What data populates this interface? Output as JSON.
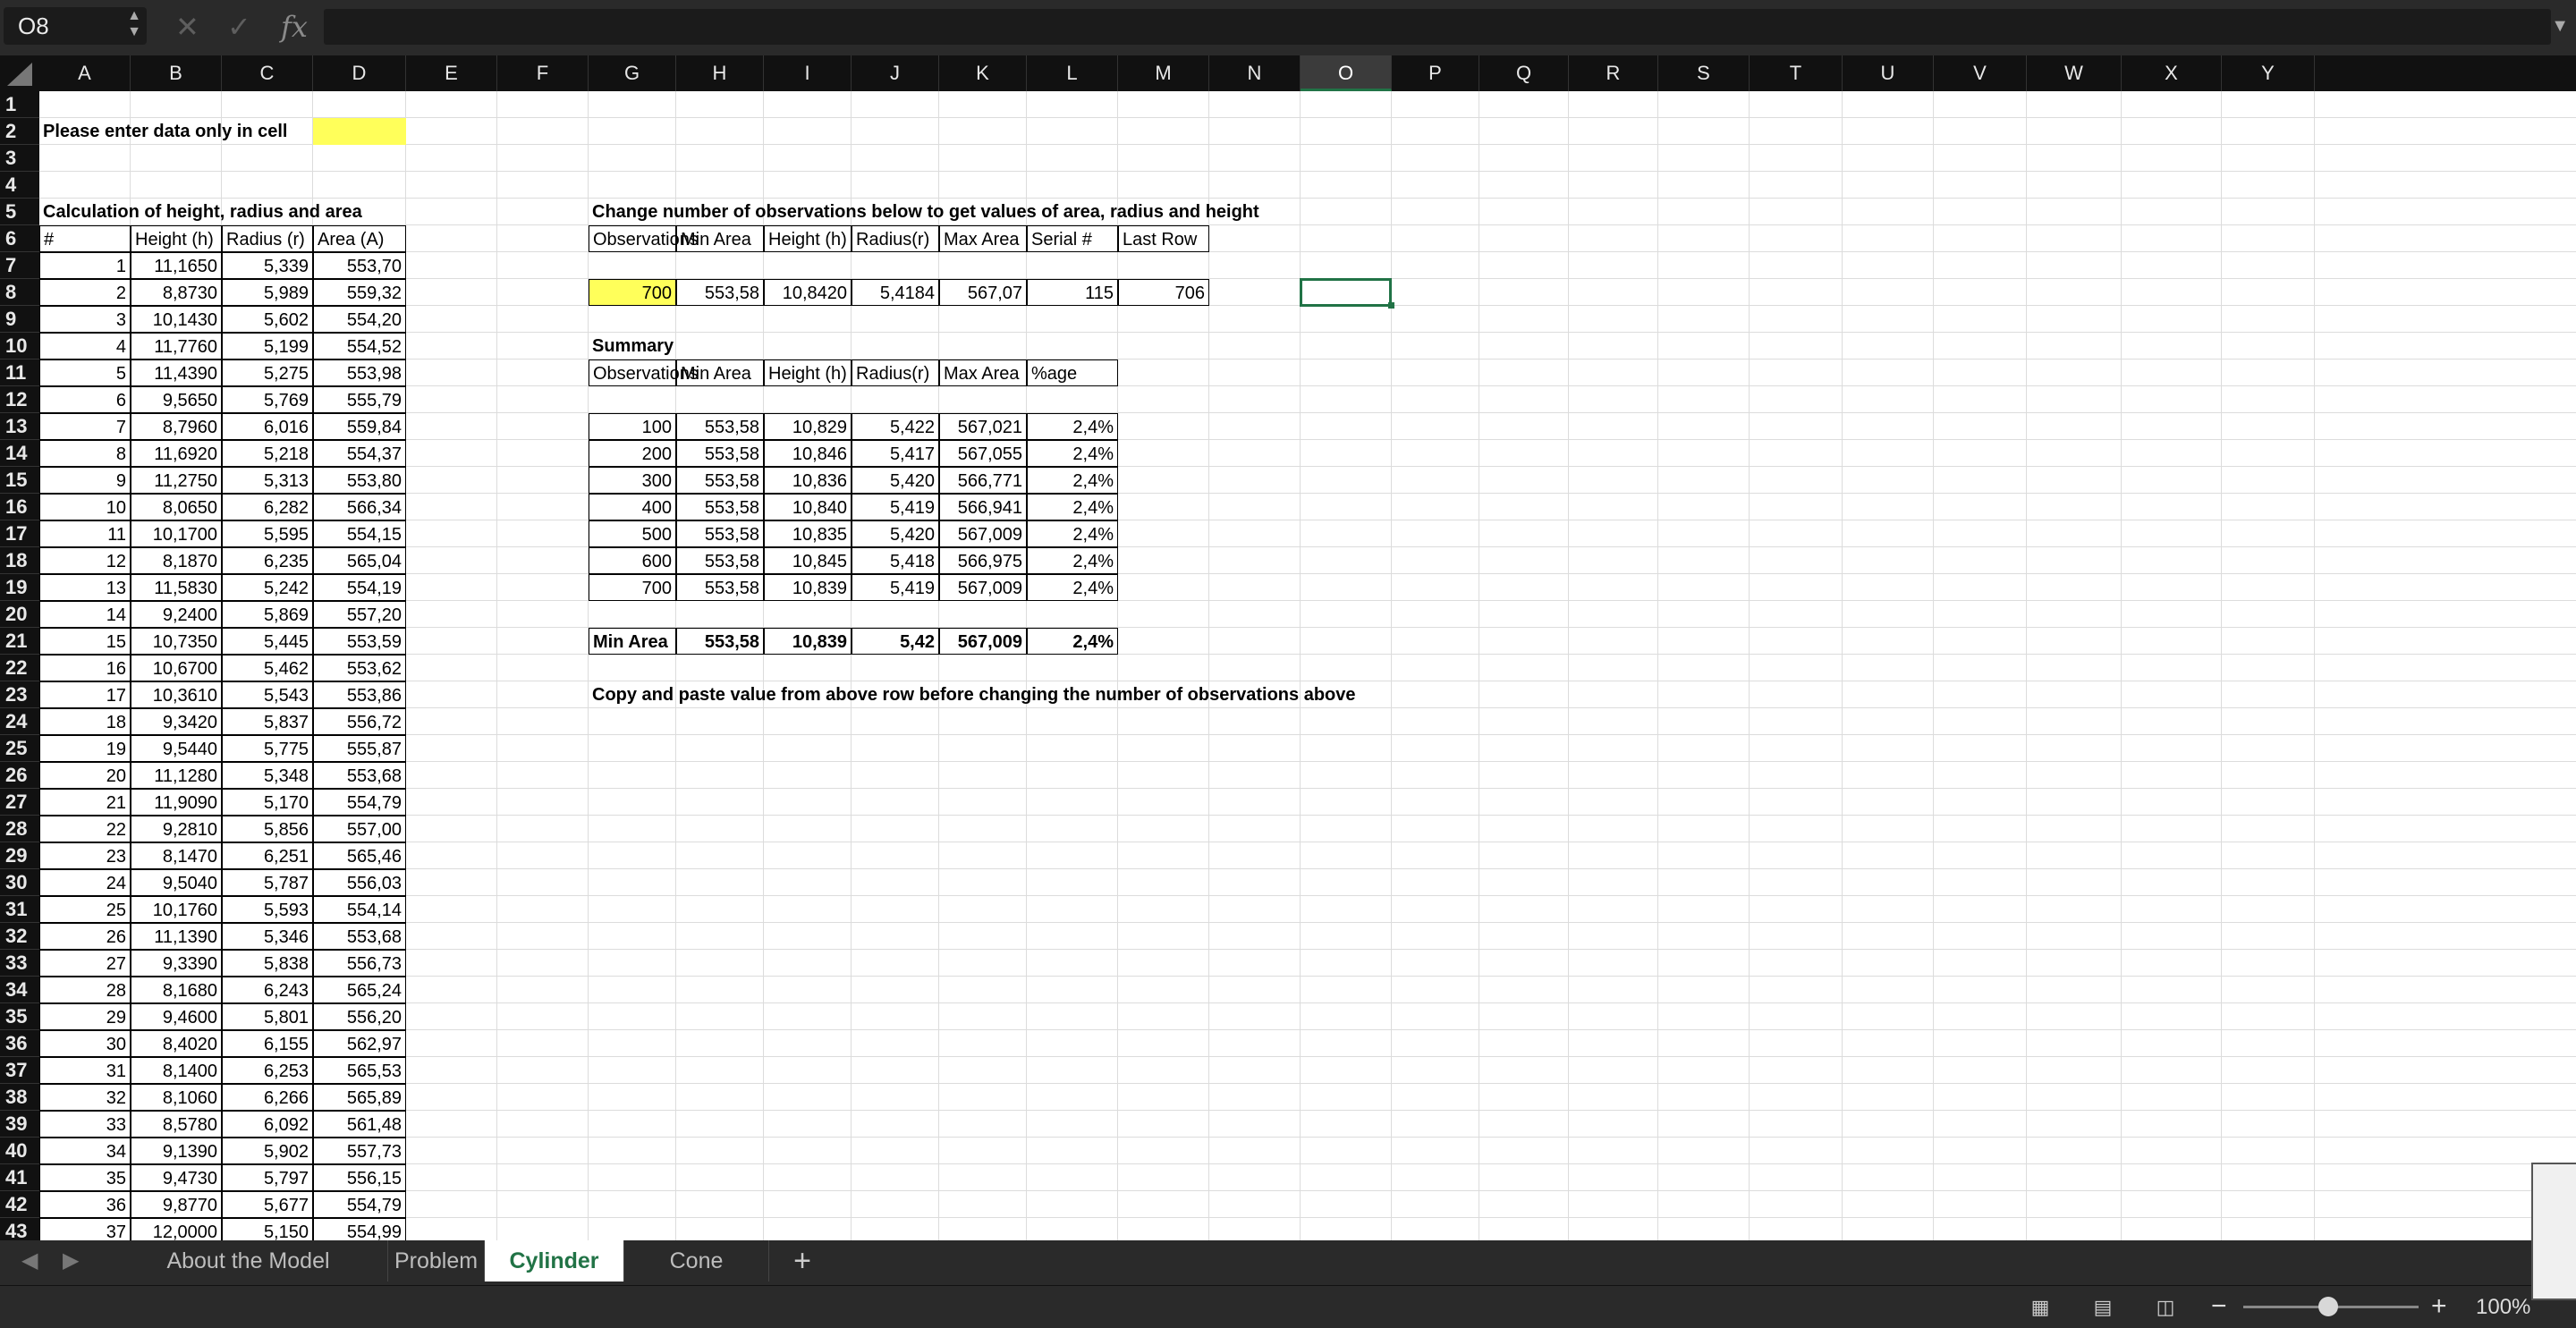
{
  "formula_bar": {
    "name_box": "O8",
    "cancel_icon": "✕",
    "confirm_icon": "✓",
    "fx_label": "fx",
    "formula": ""
  },
  "columns": [
    "A",
    "B",
    "C",
    "D",
    "E",
    "F",
    "G",
    "H",
    "I",
    "J",
    "K",
    "L",
    "M",
    "N",
    "O",
    "P",
    "Q",
    "R",
    "S",
    "T",
    "U",
    "V",
    "W",
    "X",
    "Y"
  ],
  "selected_column": "O",
  "selected_cell": "O8",
  "rows": [
    "1",
    "2",
    "3",
    "4",
    "5",
    "6",
    "7",
    "8",
    "9",
    "10",
    "11",
    "12",
    "13",
    "14",
    "15",
    "16",
    "17",
    "18",
    "19",
    "20",
    "21",
    "22",
    "23",
    "24",
    "25",
    "26",
    "27",
    "28",
    "29",
    "30",
    "31",
    "32",
    "33",
    "34",
    "35",
    "36",
    "37",
    "38",
    "39",
    "40",
    "41",
    "42",
    "43"
  ],
  "sheet": {
    "instruction": "Please enter data only in cell",
    "calc_title": "Calculation of height, radius and area",
    "calc_headers": [
      "#",
      "Height (h)",
      "Radius (r)",
      "Area (A)"
    ],
    "calc_rows": [
      [
        "1",
        "11,1650",
        "5,339",
        "553,70"
      ],
      [
        "2",
        "8,8730",
        "5,989",
        "559,32"
      ],
      [
        "3",
        "10,1430",
        "5,602",
        "554,20"
      ],
      [
        "4",
        "11,7760",
        "5,199",
        "554,52"
      ],
      [
        "5",
        "11,4390",
        "5,275",
        "553,98"
      ],
      [
        "6",
        "9,5650",
        "5,769",
        "555,79"
      ],
      [
        "7",
        "8,7960",
        "6,016",
        "559,84"
      ],
      [
        "8",
        "11,6920",
        "5,218",
        "554,37"
      ],
      [
        "9",
        "11,2750",
        "5,313",
        "553,80"
      ],
      [
        "10",
        "8,0650",
        "6,282",
        "566,34"
      ],
      [
        "11",
        "10,1700",
        "5,595",
        "554,15"
      ],
      [
        "12",
        "8,1870",
        "6,235",
        "565,04"
      ],
      [
        "13",
        "11,5830",
        "5,242",
        "554,19"
      ],
      [
        "14",
        "9,2400",
        "5,869",
        "557,20"
      ],
      [
        "15",
        "10,7350",
        "5,445",
        "553,59"
      ],
      [
        "16",
        "10,6700",
        "5,462",
        "553,62"
      ],
      [
        "17",
        "10,3610",
        "5,543",
        "553,86"
      ],
      [
        "18",
        "9,3420",
        "5,837",
        "556,72"
      ],
      [
        "19",
        "9,5440",
        "5,775",
        "555,87"
      ],
      [
        "20",
        "11,1280",
        "5,348",
        "553,68"
      ],
      [
        "21",
        "11,9090",
        "5,170",
        "554,79"
      ],
      [
        "22",
        "9,2810",
        "5,856",
        "557,00"
      ],
      [
        "23",
        "8,1470",
        "6,251",
        "565,46"
      ],
      [
        "24",
        "9,5040",
        "5,787",
        "556,03"
      ],
      [
        "25",
        "10,1760",
        "5,593",
        "554,14"
      ],
      [
        "26",
        "11,1390",
        "5,346",
        "553,68"
      ],
      [
        "27",
        "9,3390",
        "5,838",
        "556,73"
      ],
      [
        "28",
        "8,1680",
        "6,243",
        "565,24"
      ],
      [
        "29",
        "9,4600",
        "5,801",
        "556,20"
      ],
      [
        "30",
        "8,4020",
        "6,155",
        "562,97"
      ],
      [
        "31",
        "8,1400",
        "6,253",
        "565,53"
      ],
      [
        "32",
        "8,1060",
        "6,266",
        "565,89"
      ],
      [
        "33",
        "8,5780",
        "6,092",
        "561,48"
      ],
      [
        "34",
        "9,1390",
        "5,902",
        "557,73"
      ],
      [
        "35",
        "9,4730",
        "5,797",
        "556,15"
      ],
      [
        "36",
        "9,8770",
        "5,677",
        "554,79"
      ],
      [
        "37",
        "12,0000",
        "5,150",
        "554,99"
      ]
    ],
    "obs_title": "Change number of observations below to get values of area, radius and height",
    "obs_headers": [
      "Observations",
      "Min Area",
      "Height (h)",
      "Radius(r)",
      "Max Area",
      "Serial #",
      "Last Row"
    ],
    "obs_values": [
      "700",
      "553,58",
      "10,8420",
      "5,4184",
      "567,07",
      "115",
      "706"
    ],
    "summary_title": "Summary",
    "summary_headers": [
      "Observations",
      "Min Area",
      "Height (h)",
      "Radius(r)",
      "Max Area",
      "%age"
    ],
    "summary_rows": [
      [
        "100",
        "553,58",
        "10,829",
        "5,422",
        "567,021",
        "2,4%"
      ],
      [
        "200",
        "553,58",
        "10,846",
        "5,417",
        "567,055",
        "2,4%"
      ],
      [
        "300",
        "553,58",
        "10,836",
        "5,420",
        "566,771",
        "2,4%"
      ],
      [
        "400",
        "553,58",
        "10,840",
        "5,419",
        "566,941",
        "2,4%"
      ],
      [
        "500",
        "553,58",
        "10,835",
        "5,420",
        "567,009",
        "2,4%"
      ],
      [
        "600",
        "553,58",
        "10,845",
        "5,418",
        "566,975",
        "2,4%"
      ],
      [
        "700",
        "553,58",
        "10,839",
        "5,419",
        "567,009",
        "2,4%"
      ]
    ],
    "min_row": [
      "Min Area",
      "553,58",
      "10,839",
      "5,42",
      "567,009",
      "2,4%"
    ],
    "note": "Copy and paste value from above row before changing the number of observations above"
  },
  "tabs": [
    "About the Model",
    "Problem",
    "Cylinder",
    "Cone"
  ],
  "active_tab": "Cylinder",
  "add_tab_label": "+",
  "status": {
    "zoom": "100%",
    "zoom_level_percent": 100,
    "view_icons": [
      "normal-view-icon",
      "page-layout-icon",
      "page-break-icon"
    ]
  }
}
